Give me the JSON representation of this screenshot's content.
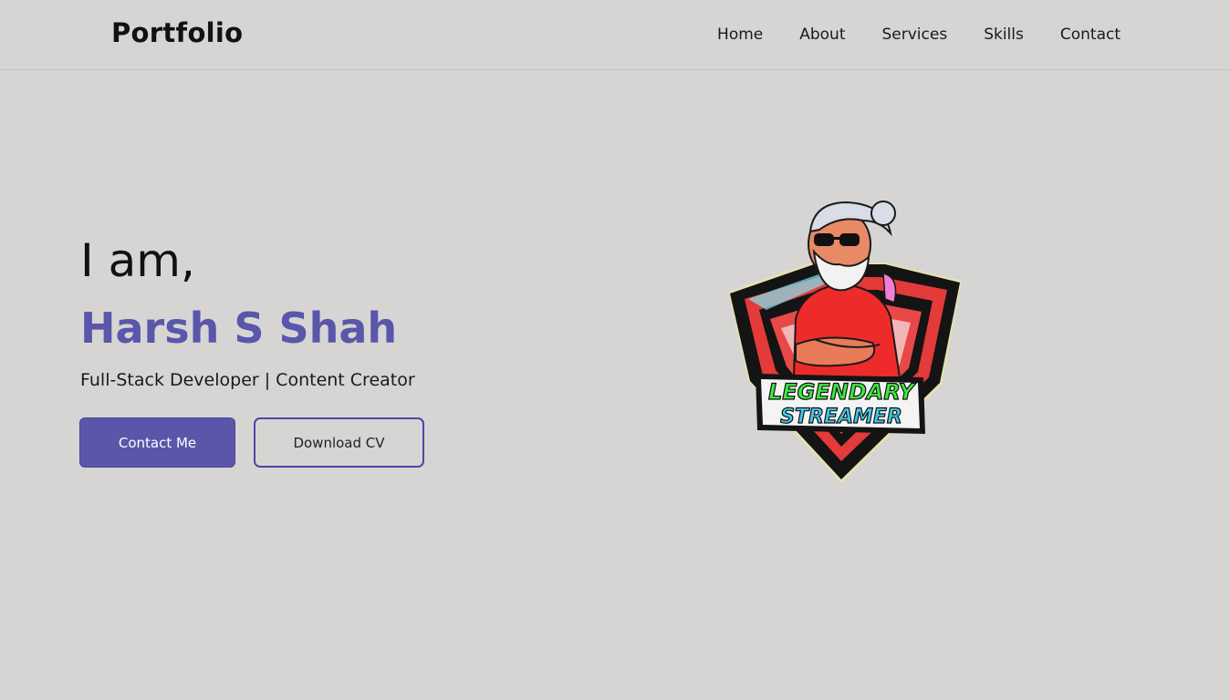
{
  "header": {
    "brand": "Portfolio",
    "nav": [
      "Home",
      "About",
      "Services",
      "Skills",
      "Contact"
    ]
  },
  "hero": {
    "greeting": "I am,",
    "name": "Harsh S Shah",
    "role": "Full-Stack Developer | Content Creator",
    "contact_button": "Contact Me",
    "download_button": "Download CV"
  },
  "logo": {
    "line1": "LEGENDARY",
    "line2": "STREAMER"
  },
  "colors": {
    "background": "#d6d5d4",
    "accent": "#5a56aa",
    "outline": "#4a46a8"
  }
}
